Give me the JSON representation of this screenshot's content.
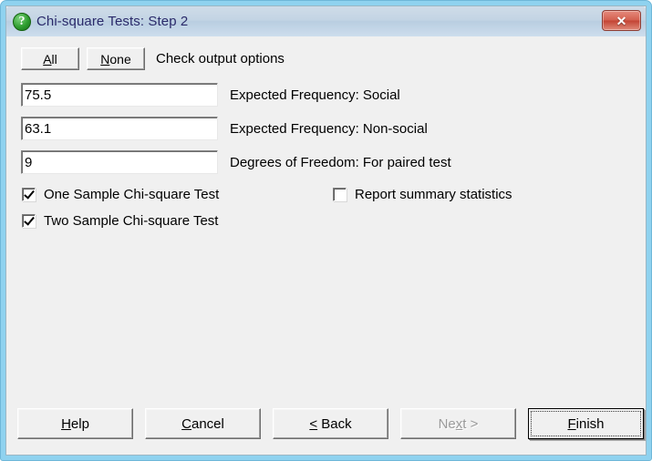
{
  "window": {
    "title": "Chi-square Tests: Step 2",
    "icon": "question-mark-icon",
    "close_label": "✕",
    "frame_color": "#8fd2ef",
    "titlebar_text_color": "#2a2a6a"
  },
  "toolbar": {
    "all_label": "All",
    "all_accel": "A",
    "none_label": "None",
    "none_accel": "N",
    "instruction": "Check output options"
  },
  "fields": [
    {
      "value": "75.5",
      "label": "Expected Frequency: Social"
    },
    {
      "value": "63.1",
      "label": "Expected Frequency: Non-social"
    },
    {
      "value": "9",
      "label": "Degrees of Freedom: For paired test"
    }
  ],
  "checkboxes": [
    {
      "label": "One Sample Chi-square Test",
      "checked": true
    },
    {
      "label": "Two Sample Chi-square Test",
      "checked": true
    },
    {
      "label": "Report summary statistics",
      "checked": false
    }
  ],
  "buttons": {
    "help": {
      "prefix": "",
      "accel": "H",
      "suffix": "elp",
      "disabled": false,
      "default": false
    },
    "cancel": {
      "prefix": "",
      "accel": "C",
      "suffix": "ancel",
      "disabled": false,
      "default": false
    },
    "back": {
      "prefix": "",
      "accel": "<",
      "suffix": " Back",
      "disabled": false,
      "default": false
    },
    "next": {
      "prefix": "Ne",
      "accel": "x",
      "suffix": "t >",
      "disabled": true,
      "default": false
    },
    "finish": {
      "prefix": "",
      "accel": "F",
      "suffix": "inish",
      "disabled": false,
      "default": true
    }
  }
}
